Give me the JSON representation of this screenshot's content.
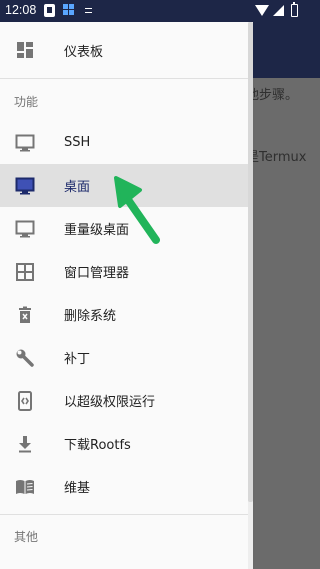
{
  "status_bar": {
    "time": "12:08"
  },
  "background": {
    "text_1": "他步骤。",
    "text_2": "是Termux"
  },
  "drawer": {
    "dashboard": {
      "label": "仪表板",
      "icon": "dashboard-icon"
    },
    "section_functions": "功能",
    "items": [
      {
        "label": "SSH",
        "icon": "monitor-icon"
      },
      {
        "label": "桌面",
        "icon": "desktop-icon",
        "active": true
      },
      {
        "label": "重量级桌面",
        "icon": "monitor-icon"
      },
      {
        "label": "窗口管理器",
        "icon": "grid-window-icon"
      },
      {
        "label": "删除系统",
        "icon": "trash-icon"
      },
      {
        "label": "补丁",
        "icon": "wrench-icon"
      },
      {
        "label": "以超级权限运行",
        "icon": "code-screen-icon"
      },
      {
        "label": "下载Rootfs",
        "icon": "download-icon"
      },
      {
        "label": "维基",
        "icon": "book-icon"
      }
    ],
    "section_other": "其他"
  },
  "colors": {
    "drawer_bg": "#fafafa",
    "active_bg": "#e0e0e0",
    "active_text": "#1d2a6b",
    "status_bar": "#1d2647",
    "scrim": "#6b6b6b",
    "annotation_arrow": "#21b45a"
  }
}
